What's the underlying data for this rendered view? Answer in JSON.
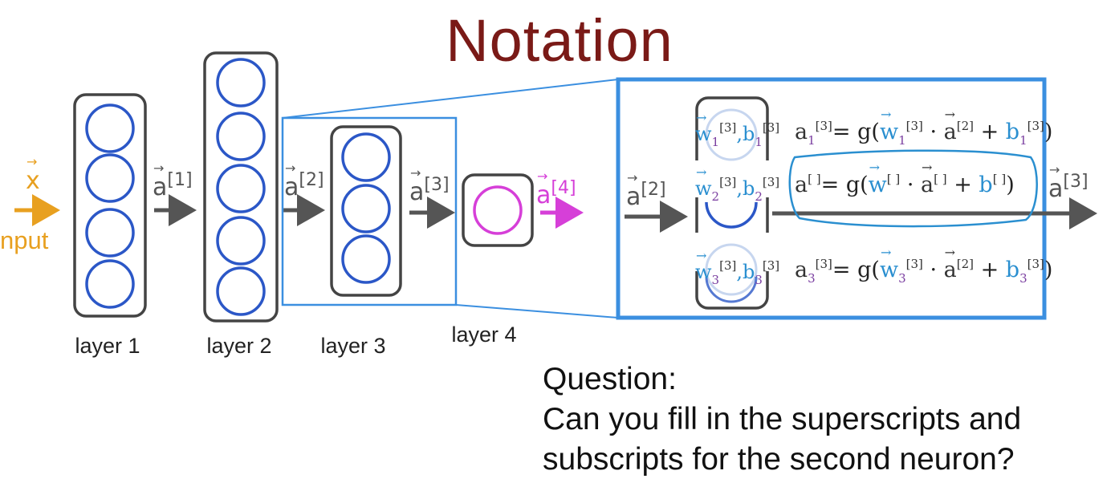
{
  "title": "Notation",
  "input": {
    "symbol": "x",
    "label": "nput"
  },
  "arrows": {
    "a1": {
      "base": "a",
      "sup": "[1]"
    },
    "a2": {
      "base": "a",
      "sup": "[2]"
    },
    "a3": {
      "base": "a",
      "sup": "[3]"
    },
    "a4": {
      "base": "a",
      "sup": "[4]"
    },
    "detail_in": {
      "base": "a",
      "sup": "[2]"
    },
    "detail_out": {
      "base": "a",
      "sup": "[3]"
    }
  },
  "layers": [
    "layer 1",
    "layer 2",
    "layer 3",
    "layer 4"
  ],
  "neurons": [
    {
      "w": "w",
      "w_sub": "1",
      "w_sup": "[3]",
      "b": "b",
      "b_sub": "1",
      "b_sup": "[3]",
      "eq": {
        "lhs": "a",
        "lhs_sub": "1",
        "lhs_sup": "[3]",
        "g": "g",
        "w_sub": "1",
        "w_sup": "[3]",
        "a_sup": "[2]",
        "b_sub": "1",
        "b_sup": "[3]"
      }
    },
    {
      "w": "w",
      "w_sub": "2",
      "w_sup": "[3]",
      "b": "b",
      "b_sub": "2",
      "b_sup": "[3]",
      "eq": {
        "lhs": "a",
        "lhs_sub": "",
        "lhs_sup": "[ ]",
        "g": "g",
        "w_sub": "",
        "w_sup": "[ ]",
        "a_sup": "[ ]",
        "b_sub": "",
        "b_sup": "[ ]"
      }
    },
    {
      "w": "w",
      "w_sub": "3",
      "w_sup": "[3]",
      "b": "b",
      "b_sub": "3",
      "b_sup": "[3]",
      "eq": {
        "lhs": "a",
        "lhs_sub": "3",
        "lhs_sup": "[3]",
        "g": "g",
        "w_sub": "3",
        "w_sup": "[3]",
        "a_sup": "[2]",
        "b_sub": "3",
        "b_sup": "[3]"
      }
    }
  ],
  "question": {
    "line1": "Question:",
    "line2": "Can you fill in the superscripts and",
    "line3": "subscripts for the second neuron?"
  },
  "colors": {
    "title": "#7a1a17",
    "input": "#e8a020",
    "neuron": "#2b57c7",
    "output_neuron": "#d63fd8",
    "zoom_box": "#3b8fe0",
    "arrow": "#555555"
  }
}
